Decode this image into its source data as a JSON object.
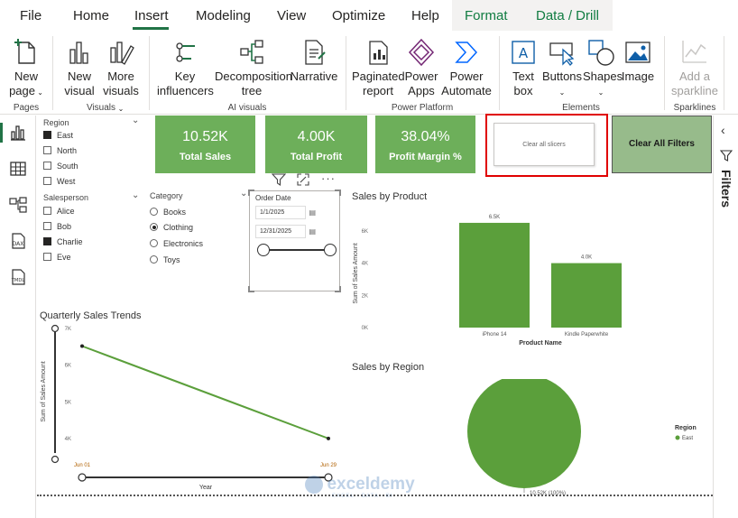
{
  "menu": {
    "items": [
      "File",
      "Home",
      "Insert",
      "Modeling",
      "View",
      "Optimize",
      "Help",
      "Format",
      "Data / Drill"
    ],
    "active": "Insert"
  },
  "ribbon": {
    "new_page": [
      "New",
      "page"
    ],
    "new_visual": [
      "New",
      "visual"
    ],
    "more_visuals": [
      "More",
      "visuals"
    ],
    "key_influencers": [
      "Key",
      "influencers"
    ],
    "decomposition_tree": [
      "Decomposition",
      "tree"
    ],
    "narrative": "Narrative",
    "paginated_report": [
      "Paginated",
      "report"
    ],
    "power_apps": [
      "Power",
      "Apps"
    ],
    "power_automate": [
      "Power",
      "Automate"
    ],
    "text_box": [
      "Text",
      "box"
    ],
    "buttons": "Buttons",
    "shapes": "Shapes",
    "image": "Image",
    "add_sparkline": [
      "Add a",
      "sparkline"
    ],
    "groups": {
      "pages": "Pages",
      "visuals": "Visuals",
      "ai_visuals": "AI visuals",
      "power_platform": "Power Platform",
      "elements": "Elements",
      "sparklines": "Sparklines"
    }
  },
  "filters_label": "Filters",
  "region_slicer": {
    "title": "Region",
    "items": [
      {
        "label": "East",
        "checked": true
      },
      {
        "label": "North",
        "checked": false
      },
      {
        "label": "South",
        "checked": false
      },
      {
        "label": "West",
        "checked": false
      }
    ]
  },
  "salesperson_slicer": {
    "title": "Salesperson",
    "items": [
      {
        "label": "Alice",
        "checked": false
      },
      {
        "label": "Bob",
        "checked": false
      },
      {
        "label": "Charlie",
        "checked": true
      },
      {
        "label": "Eve",
        "checked": false
      }
    ]
  },
  "category_slicer": {
    "title": "Category",
    "items": [
      {
        "label": "Books",
        "selected": false
      },
      {
        "label": "Clothing",
        "selected": true
      },
      {
        "label": "Electronics",
        "selected": false
      },
      {
        "label": "Toys",
        "selected": false
      }
    ]
  },
  "date_slicer": {
    "title": "Order Date",
    "start": "1/1/2025",
    "end": "12/31/2025"
  },
  "kpis": [
    {
      "value": "10.52K",
      "label": "Total Sales"
    },
    {
      "value": "4.00K",
      "label": "Total Profit"
    },
    {
      "value": "38.04%",
      "label": "Profit Margin %"
    }
  ],
  "clear_slicers_button": "Clear all slicers",
  "clear_filters_button": "Clear All Filters",
  "colors": {
    "accent": "#217346",
    "kpi_green": "#6daf5a",
    "bar_green": "#5b9f3b",
    "selection_red": "#e00000",
    "clear_filters_bg": "#97bb8b"
  },
  "charts": {
    "sales_by_product": {
      "type": "bar",
      "title": "Sales by Product",
      "categories": [
        "iPhone 14",
        "Kindle Paperwhite"
      ],
      "values": [
        6.5,
        4.0
      ],
      "data_labels": [
        "6.5K",
        "4.0K"
      ],
      "xlabel": "Product Name",
      "ylabel": "Sum of Sales Amount",
      "yticks": [
        "0K",
        "2K",
        "4K",
        "6K"
      ],
      "ylim": [
        0,
        7
      ]
    },
    "quarterly_trends": {
      "type": "line",
      "title": "Quarterly Sales Trends",
      "x": [
        "Jun 01",
        "Jun 29"
      ],
      "values": [
        6.52,
        4.0
      ],
      "xlabel": "Year",
      "ylabel": "Sum of Sales Amount",
      "yticks": [
        "4K",
        "5K",
        "6K",
        "7K"
      ],
      "ylim": [
        3.8,
        7
      ]
    },
    "sales_by_region": {
      "type": "pie",
      "title": "Sales by Region",
      "slices": [
        {
          "name": "East",
          "value": 10.52
        }
      ],
      "data_label": "10.52K (100%)",
      "legend_title": "Region",
      "legend": [
        "East"
      ]
    }
  },
  "watermark": {
    "brand": "exceldemy",
    "tagline": "EXCEL · DATA · BI"
  }
}
